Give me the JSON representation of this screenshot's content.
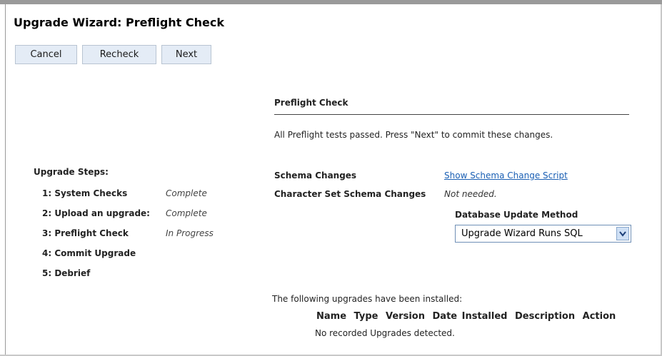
{
  "title": "Upgrade Wizard: Preflight Check",
  "buttons": {
    "cancel": "Cancel",
    "recheck": "Recheck",
    "next": "Next"
  },
  "steps": {
    "heading": "Upgrade Steps:",
    "items": [
      {
        "label": "1: System Checks",
        "status": "Complete"
      },
      {
        "label": "2: Upload an upgrade:",
        "status": "Complete"
      },
      {
        "label": "3: Preflight Check",
        "status": "In Progress"
      },
      {
        "label": "4: Commit Upgrade",
        "status": ""
      },
      {
        "label": "5: Debrief",
        "status": ""
      }
    ]
  },
  "preflight": {
    "title": "Preflight Check",
    "message": "All Preflight tests passed. Press \"Next\" to commit these changes.",
    "schema_changes_label": "Schema Changes",
    "schema_changes_link": "Show Schema Change Script",
    "charset_label": "Character Set Schema Changes",
    "charset_value": "Not needed.",
    "db_update_label": "Database Update Method",
    "db_update_selected": "Upgrade Wizard Runs SQL"
  },
  "installed": {
    "intro": "The following upgrades have been installed:",
    "columns": [
      "Name",
      "Type",
      "Version",
      "Date Installed",
      "Description",
      "Action"
    ],
    "empty": "No recorded Upgrades detected."
  },
  "icons": {
    "select_arrow": "chevron-down-icon"
  },
  "colors": {
    "link": "#1a5fb4",
    "button_bg": "#e4ecf6",
    "select_arrow_bg": "#cfe0f5"
  }
}
